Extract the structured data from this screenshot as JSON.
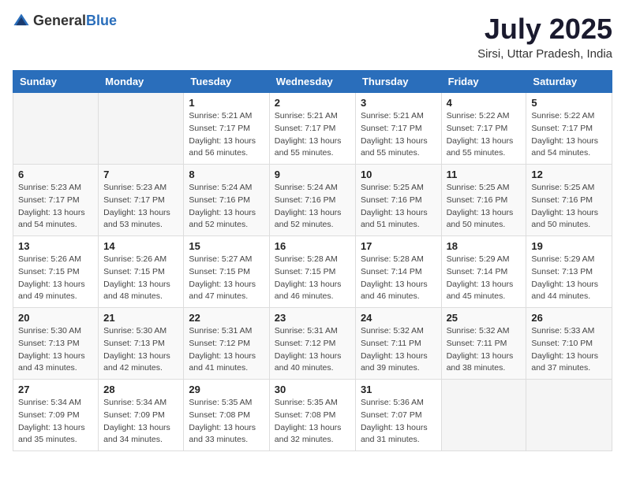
{
  "header": {
    "logo": {
      "text_general": "General",
      "text_blue": "Blue"
    },
    "title": "July 2025",
    "location": "Sirsi, Uttar Pradesh, India"
  },
  "calendar": {
    "weekdays": [
      "Sunday",
      "Monday",
      "Tuesday",
      "Wednesday",
      "Thursday",
      "Friday",
      "Saturday"
    ],
    "weeks": [
      [
        {
          "day": "",
          "info": ""
        },
        {
          "day": "",
          "info": ""
        },
        {
          "day": "1",
          "info": "Sunrise: 5:21 AM\nSunset: 7:17 PM\nDaylight: 13 hours and 56 minutes."
        },
        {
          "day": "2",
          "info": "Sunrise: 5:21 AM\nSunset: 7:17 PM\nDaylight: 13 hours and 55 minutes."
        },
        {
          "day": "3",
          "info": "Sunrise: 5:21 AM\nSunset: 7:17 PM\nDaylight: 13 hours and 55 minutes."
        },
        {
          "day": "4",
          "info": "Sunrise: 5:22 AM\nSunset: 7:17 PM\nDaylight: 13 hours and 55 minutes."
        },
        {
          "day": "5",
          "info": "Sunrise: 5:22 AM\nSunset: 7:17 PM\nDaylight: 13 hours and 54 minutes."
        }
      ],
      [
        {
          "day": "6",
          "info": "Sunrise: 5:23 AM\nSunset: 7:17 PM\nDaylight: 13 hours and 54 minutes."
        },
        {
          "day": "7",
          "info": "Sunrise: 5:23 AM\nSunset: 7:17 PM\nDaylight: 13 hours and 53 minutes."
        },
        {
          "day": "8",
          "info": "Sunrise: 5:24 AM\nSunset: 7:16 PM\nDaylight: 13 hours and 52 minutes."
        },
        {
          "day": "9",
          "info": "Sunrise: 5:24 AM\nSunset: 7:16 PM\nDaylight: 13 hours and 52 minutes."
        },
        {
          "day": "10",
          "info": "Sunrise: 5:25 AM\nSunset: 7:16 PM\nDaylight: 13 hours and 51 minutes."
        },
        {
          "day": "11",
          "info": "Sunrise: 5:25 AM\nSunset: 7:16 PM\nDaylight: 13 hours and 50 minutes."
        },
        {
          "day": "12",
          "info": "Sunrise: 5:25 AM\nSunset: 7:16 PM\nDaylight: 13 hours and 50 minutes."
        }
      ],
      [
        {
          "day": "13",
          "info": "Sunrise: 5:26 AM\nSunset: 7:15 PM\nDaylight: 13 hours and 49 minutes."
        },
        {
          "day": "14",
          "info": "Sunrise: 5:26 AM\nSunset: 7:15 PM\nDaylight: 13 hours and 48 minutes."
        },
        {
          "day": "15",
          "info": "Sunrise: 5:27 AM\nSunset: 7:15 PM\nDaylight: 13 hours and 47 minutes."
        },
        {
          "day": "16",
          "info": "Sunrise: 5:28 AM\nSunset: 7:15 PM\nDaylight: 13 hours and 46 minutes."
        },
        {
          "day": "17",
          "info": "Sunrise: 5:28 AM\nSunset: 7:14 PM\nDaylight: 13 hours and 46 minutes."
        },
        {
          "day": "18",
          "info": "Sunrise: 5:29 AM\nSunset: 7:14 PM\nDaylight: 13 hours and 45 minutes."
        },
        {
          "day": "19",
          "info": "Sunrise: 5:29 AM\nSunset: 7:13 PM\nDaylight: 13 hours and 44 minutes."
        }
      ],
      [
        {
          "day": "20",
          "info": "Sunrise: 5:30 AM\nSunset: 7:13 PM\nDaylight: 13 hours and 43 minutes."
        },
        {
          "day": "21",
          "info": "Sunrise: 5:30 AM\nSunset: 7:13 PM\nDaylight: 13 hours and 42 minutes."
        },
        {
          "day": "22",
          "info": "Sunrise: 5:31 AM\nSunset: 7:12 PM\nDaylight: 13 hours and 41 minutes."
        },
        {
          "day": "23",
          "info": "Sunrise: 5:31 AM\nSunset: 7:12 PM\nDaylight: 13 hours and 40 minutes."
        },
        {
          "day": "24",
          "info": "Sunrise: 5:32 AM\nSunset: 7:11 PM\nDaylight: 13 hours and 39 minutes."
        },
        {
          "day": "25",
          "info": "Sunrise: 5:32 AM\nSunset: 7:11 PM\nDaylight: 13 hours and 38 minutes."
        },
        {
          "day": "26",
          "info": "Sunrise: 5:33 AM\nSunset: 7:10 PM\nDaylight: 13 hours and 37 minutes."
        }
      ],
      [
        {
          "day": "27",
          "info": "Sunrise: 5:34 AM\nSunset: 7:09 PM\nDaylight: 13 hours and 35 minutes."
        },
        {
          "day": "28",
          "info": "Sunrise: 5:34 AM\nSunset: 7:09 PM\nDaylight: 13 hours and 34 minutes."
        },
        {
          "day": "29",
          "info": "Sunrise: 5:35 AM\nSunset: 7:08 PM\nDaylight: 13 hours and 33 minutes."
        },
        {
          "day": "30",
          "info": "Sunrise: 5:35 AM\nSunset: 7:08 PM\nDaylight: 13 hours and 32 minutes."
        },
        {
          "day": "31",
          "info": "Sunrise: 5:36 AM\nSunset: 7:07 PM\nDaylight: 13 hours and 31 minutes."
        },
        {
          "day": "",
          "info": ""
        },
        {
          "day": "",
          "info": ""
        }
      ]
    ]
  }
}
